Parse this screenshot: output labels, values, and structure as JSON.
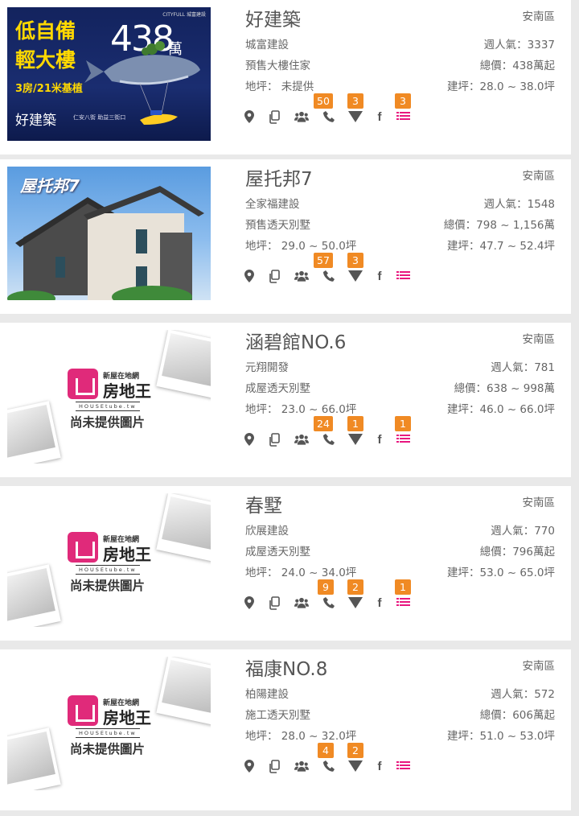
{
  "listings": [
    {
      "title": "好建築",
      "area": "安南區",
      "builder": "城富建設",
      "type": "預售大樓住家",
      "land": "地坪： 未提供",
      "popularity": "週人氣：3337",
      "price": "總價：438萬起",
      "build": "建坪：28.0 ~ 38.0坪",
      "badges": {
        "phone": "50",
        "map": "3",
        "list": "3"
      },
      "thumb_text": {
        "tag1": "低自備",
        "tag2": "輕大樓",
        "price": "438",
        "unit": "萬",
        "rooms": "3房/21米基植",
        "brand": "好建築",
        "sub": "仁安八街 助益三街口",
        "corner": "CITYFULL 城富建設"
      }
    },
    {
      "title": "屋托邦7",
      "area": "安南區",
      "builder": "全家福建設",
      "type": "預售透天別墅",
      "land": "地坪： 29.0 ~ 50.0坪",
      "popularity": "週人氣：1548",
      "price": "總價：798 ~ 1,156萬",
      "build": "建坪：47.7 ~ 52.4坪",
      "badges": {
        "phone": "57",
        "map": "3",
        "list": ""
      },
      "thumb_text": {
        "logo": "屋托邦7"
      }
    },
    {
      "title": "涵碧館NO.6",
      "area": "安南區",
      "builder": "元翔開發",
      "type": "成屋透天別墅",
      "land": "地坪： 23.0 ~ 66.0坪",
      "popularity": "週人氣：781",
      "price": "總價：638 ~ 998萬",
      "build": "建坪：46.0 ~ 66.0坪",
      "badges": {
        "phone": "24",
        "map": "1",
        "list": "1"
      }
    },
    {
      "title": "春墅",
      "area": "安南區",
      "builder": "欣展建設",
      "type": "成屋透天別墅",
      "land": "地坪： 24.0 ~ 34.0坪",
      "popularity": "週人氣：770",
      "price": "總價：796萬起",
      "build": "建坪：53.0 ~ 65.0坪",
      "badges": {
        "phone": "9",
        "map": "2",
        "list": "1"
      }
    },
    {
      "title": "福康NO.8",
      "area": "安南區",
      "builder": "柏陽建設",
      "type": "施工透天別墅",
      "land": "地坪： 28.0 ~ 32.0坪",
      "popularity": "週人氣：572",
      "price": "總價：606萬起",
      "build": "建坪：51.0 ~ 53.0坪",
      "badges": {
        "phone": "4",
        "map": "2",
        "list": ""
      }
    }
  ],
  "placeholder": {
    "small": "新屋在地網",
    "big": "房地王",
    "en": "HOUSEtube.tw",
    "text": "尚未提供圖片"
  },
  "icons": {
    "fb": "f"
  },
  "colors": {
    "badge": "#f08a24",
    "list_icon": "#e8177f",
    "brand_pink": "#e02a7a",
    "ad_bg": "#0f1f5c"
  }
}
